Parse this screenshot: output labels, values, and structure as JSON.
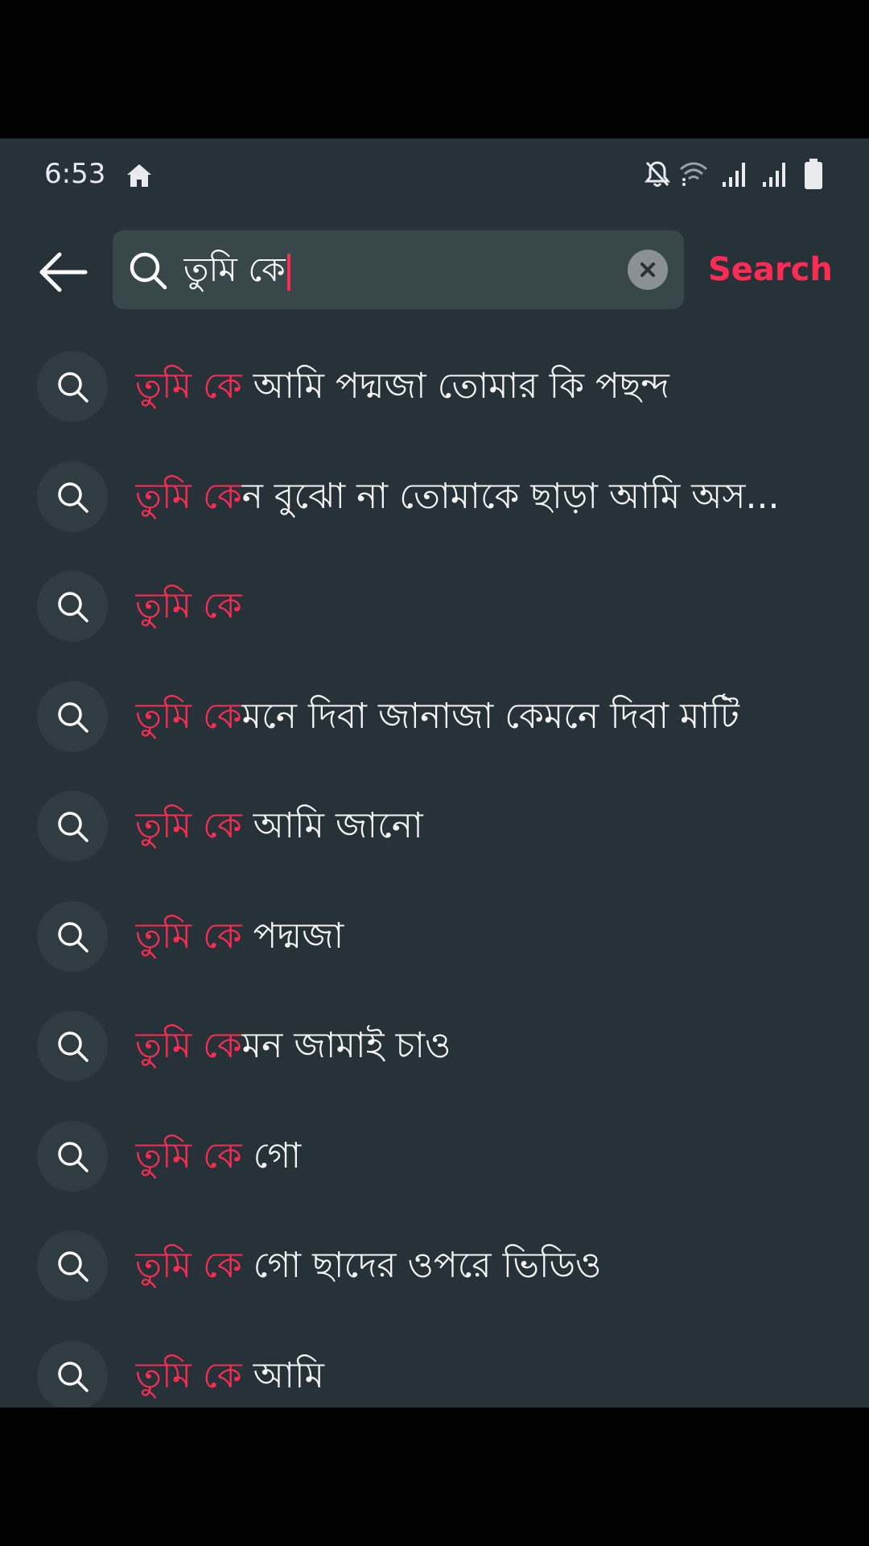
{
  "status_bar": {
    "time": "6:53",
    "icons": [
      "home-icon",
      "mute-icon",
      "wifi-icon",
      "signal-icon",
      "signal-icon",
      "battery-icon"
    ]
  },
  "search": {
    "query": "তুমি কে",
    "submit_label": "Search",
    "icons": [
      "back-arrow-icon",
      "search-icon",
      "clear-icon"
    ]
  },
  "colors": {
    "accent": "#fe2c55",
    "background": "#263238",
    "text": "#f5f5f5"
  },
  "suggestions": [
    {
      "highlight": "তুমি কে",
      "rest": " আমি পদ্মজা তোমার কি পছন্দ"
    },
    {
      "highlight": "তুমি কে",
      "rest": "ন বুঝো না তোমাকে ছাড়া আমি অস..."
    },
    {
      "highlight": "তুমি কে",
      "rest": ""
    },
    {
      "highlight": "তুমি কে",
      "rest": "মনে দিবা জানাজা কেমনে দিবা মাটি"
    },
    {
      "highlight": "তুমি কে",
      "rest": " আমি জানো"
    },
    {
      "highlight": "তুমি কে",
      "rest": " পদ্মজা"
    },
    {
      "highlight": "তুমি কে",
      "rest": "মন জামাই চাও"
    },
    {
      "highlight": "তুমি কে",
      "rest": " গো"
    },
    {
      "highlight": "তুমি কে",
      "rest": " গো ছাদের ওপরে ভিডিও"
    },
    {
      "highlight": "তুমি কে",
      "rest": " আমি"
    }
  ]
}
